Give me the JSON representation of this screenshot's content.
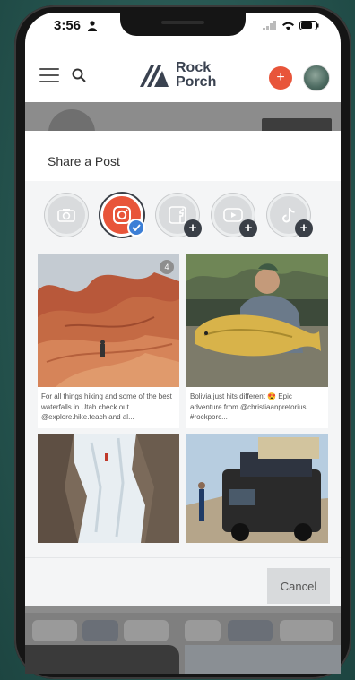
{
  "status_bar": {
    "time": "3:56"
  },
  "header": {
    "logo_line1": "Rock",
    "logo_line2": "Porch",
    "add_label": "+"
  },
  "modal": {
    "title": "Share a Post",
    "platforms": [
      {
        "name": "camera",
        "active": false
      },
      {
        "name": "instagram",
        "active": true
      },
      {
        "name": "facebook",
        "active": false,
        "add": "+"
      },
      {
        "name": "youtube",
        "active": false,
        "add": "+"
      },
      {
        "name": "tiktok",
        "active": false,
        "add": "+"
      }
    ],
    "posts": [
      {
        "badge": "4",
        "caption": "For all things hiking and some of the best waterfalls in Utah check out @explore.hike.teach and al..."
      },
      {
        "caption": "Bolivia just hits different 😍 Epic adventure from @christiaanpretorius #rockporc..."
      },
      {
        "caption": ""
      },
      {
        "caption": ""
      }
    ],
    "cancel_label": "Cancel"
  }
}
